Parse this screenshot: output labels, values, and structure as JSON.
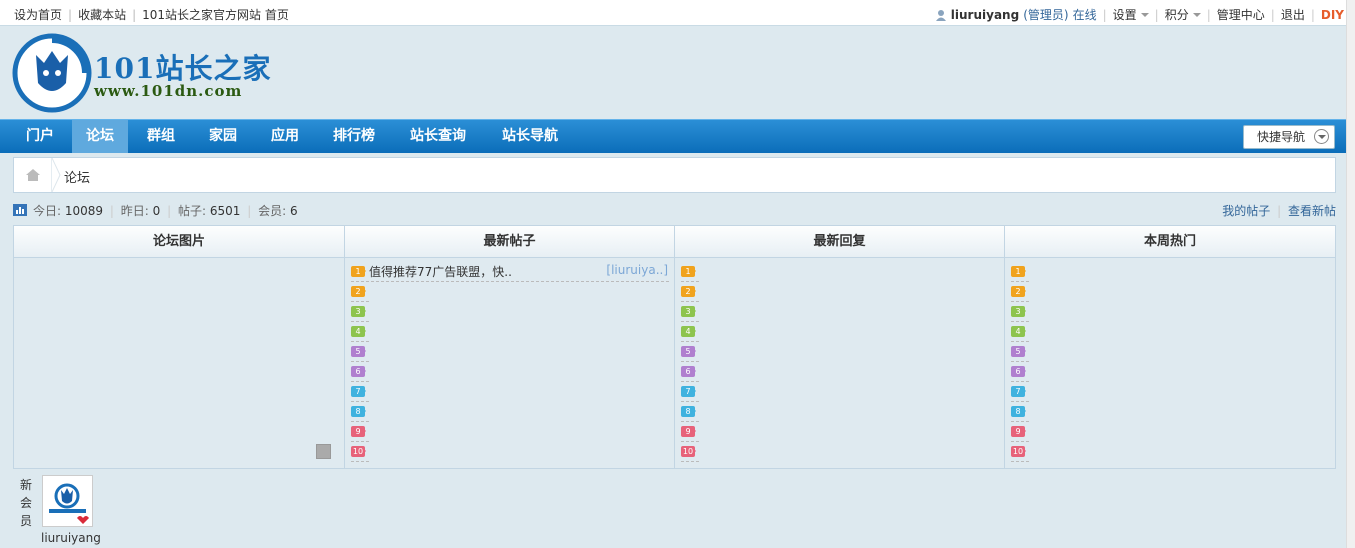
{
  "topbar": {
    "left_links": [
      "设为首页",
      "收藏本站",
      "101站长之家官方网站 首页"
    ],
    "username": "liuruiyang",
    "role": "(管理员)",
    "status": "在线",
    "settings": "设置",
    "points": "积分",
    "admin": "管理中心",
    "logout": "退出",
    "diy": "DIY"
  },
  "logo": {
    "name": "101站长之家",
    "url": "www.101dn.com"
  },
  "nav": {
    "items": [
      "门户",
      "论坛",
      "群组",
      "家园",
      "应用",
      "排行榜",
      "站长查询",
      "站长导航"
    ],
    "active_index": 1,
    "quick_nav": "快捷导航"
  },
  "breadcrumb": {
    "current": "论坛"
  },
  "stats": {
    "today_label": "今日:",
    "today_value": "10089",
    "yesterday_label": "昨日:",
    "yesterday_value": "0",
    "posts_label": "帖子:",
    "posts_value": "6501",
    "members_label": "会员:",
    "members_value": "6",
    "my_posts": "我的帖子",
    "new_posts": "查看新帖"
  },
  "grid": {
    "headers": [
      "论坛图片",
      "最新帖子",
      "最新回复",
      "本周热门"
    ],
    "latest_posts": [
      {
        "title": "值得推荐77广告联盟，快..",
        "author": "[liuruiya..]"
      }
    ],
    "rank_labels": [
      "1",
      "2",
      "3",
      "4",
      "5",
      "6",
      "7",
      "8",
      "9",
      "10"
    ],
    "rank_colors": [
      "#f0a31e",
      "#f0a31e",
      "#8dc44e",
      "#8dc44e",
      "#b07fcf",
      "#b07fcf",
      "#3fb2df",
      "#3fb2df",
      "#e7627a",
      "#e7627a"
    ]
  },
  "new_member": {
    "label": "新会员",
    "name": "liuruiyang"
  },
  "colors": {
    "nav_blue": "#0b6db9",
    "link_blue": "#336699",
    "diy_orange": "#e65c2b"
  }
}
